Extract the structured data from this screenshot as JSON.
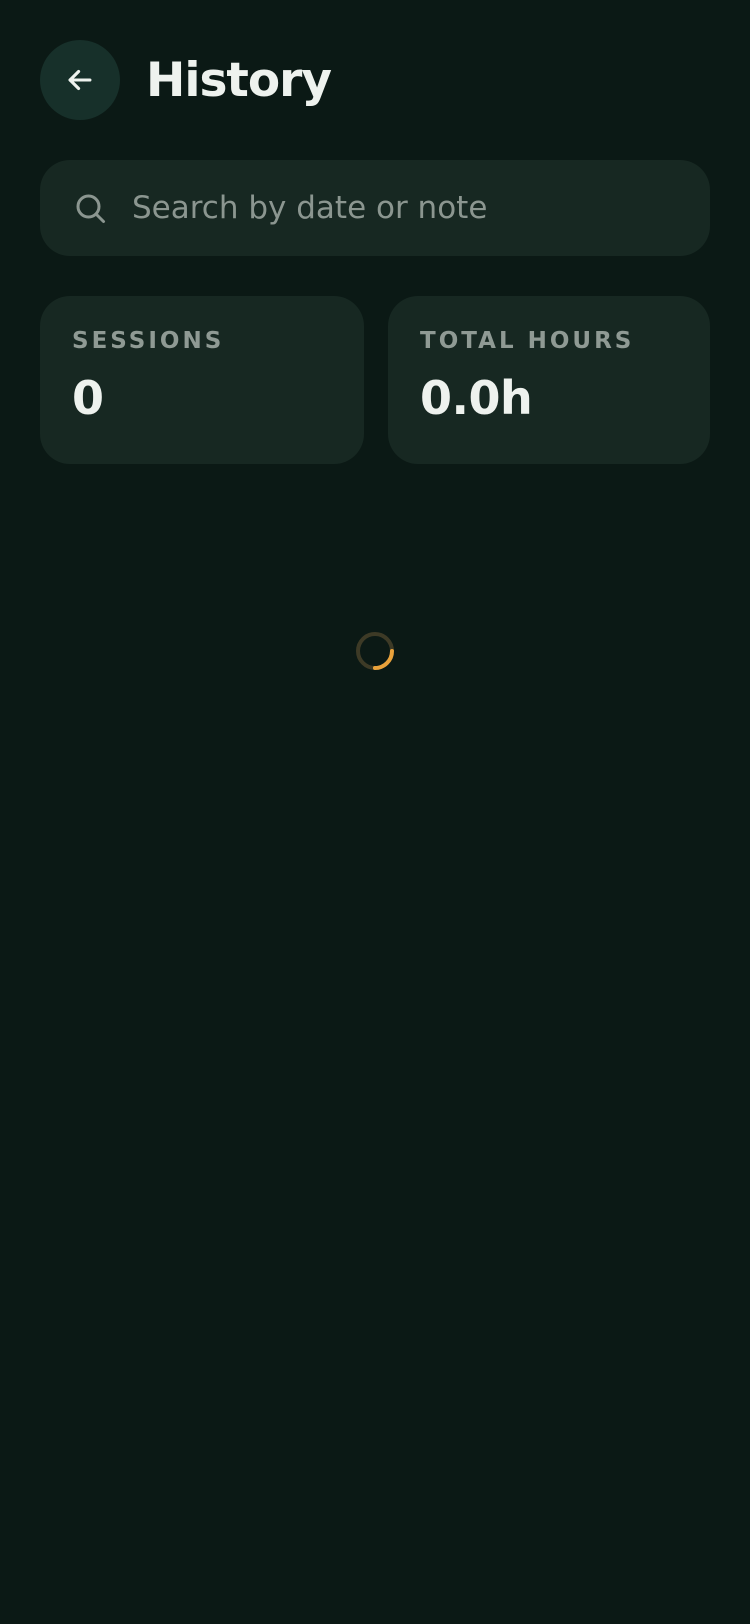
{
  "header": {
    "title": "History",
    "back_icon": "arrow-left-icon"
  },
  "search": {
    "placeholder": "Search by date or note",
    "value": "",
    "icon": "search-icon"
  },
  "stats": [
    {
      "label": "SESSIONS",
      "value": "0"
    },
    {
      "label": "TOTAL HOURS",
      "value": "0.0h"
    }
  ],
  "loading": {
    "state": "loading",
    "progress": 0.25
  },
  "colors": {
    "background": "#0b1915",
    "card": "#172822",
    "text": "#eef2ee",
    "muted": "#8f9a94",
    "accent": "#e9a23b"
  }
}
